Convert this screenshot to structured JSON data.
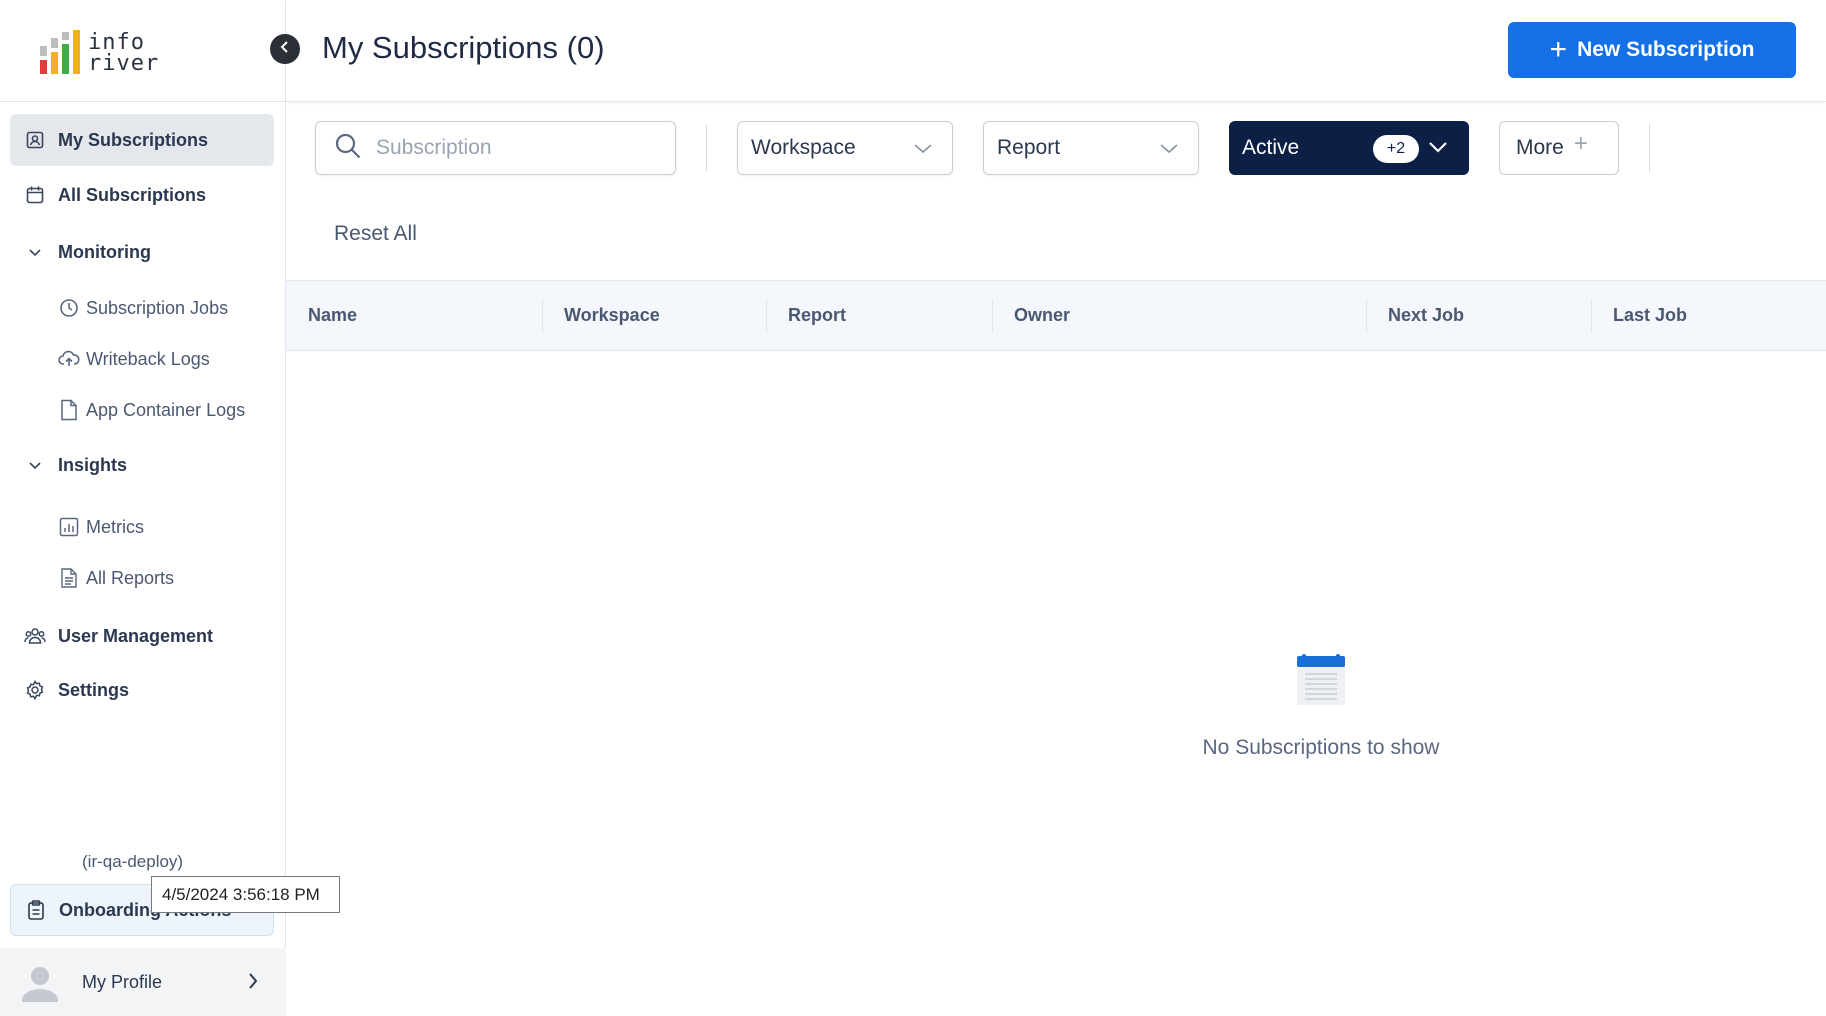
{
  "app": {
    "logo_line1": "info",
    "logo_line2": "river",
    "page_title": "My Subscriptions (0)",
    "new_button_label": "New Subscription"
  },
  "sidebar": {
    "items": [
      {
        "label": "My Subscriptions",
        "icon": "subscription-icon",
        "active": true
      },
      {
        "label": "All Subscriptions",
        "icon": "calendar-icon"
      },
      {
        "label": "Monitoring",
        "icon": "chevron-down-icon"
      },
      {
        "label": "Subscription Jobs",
        "icon": "clock-icon"
      },
      {
        "label": "Writeback Logs",
        "icon": "cloud-upload-icon"
      },
      {
        "label": "App Container Logs",
        "icon": "file-icon"
      },
      {
        "label": "Insights",
        "icon": "chevron-down-icon"
      },
      {
        "label": "Metrics",
        "icon": "chart-icon"
      },
      {
        "label": "All Reports",
        "icon": "report-icon"
      },
      {
        "label": "User Management",
        "icon": "users-icon"
      },
      {
        "label": "Settings",
        "icon": "gear-icon"
      }
    ],
    "tenant": "(ir-qa-deploy)",
    "onboarding_label": "Onboarding Actions",
    "tooltip": "4/5/2024 3:56:18 PM",
    "profile_label": "My Profile"
  },
  "filters": {
    "search_placeholder": "Subscription",
    "workspace_label": "Workspace",
    "report_label": "Report",
    "status_label": "Active",
    "status_badge": "+2",
    "more_label": "More",
    "reset_label": "Reset All"
  },
  "table": {
    "columns": [
      "Name",
      "Workspace",
      "Report",
      "Owner",
      "Next Job",
      "Last Job"
    ],
    "empty_message": "No Subscriptions to show"
  },
  "colors": {
    "primary": "#1570e6",
    "navy": "#0c1f44",
    "active_nav": "#e4e7ec"
  }
}
